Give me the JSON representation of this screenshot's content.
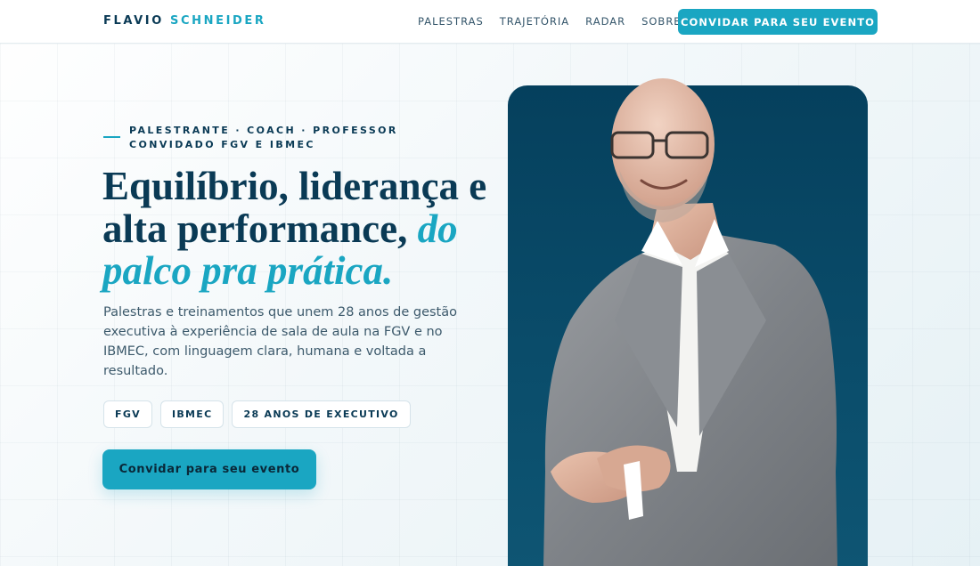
{
  "header": {
    "brand_first": "FLAVIO",
    "brand_second": "SCHNEIDER",
    "nav": [
      "PALESTRAS",
      "TRAJETÓRIA",
      "RADAR",
      "SOBRE"
    ],
    "cta": "CONVIDAR PARA SEU EVENTO"
  },
  "hero": {
    "eyebrow": "PALESTRANTE · COACH · PROFESSOR CONVIDADO FGV E IBMEC",
    "headline_line1": "Equilíbrio, liderança e",
    "headline_line2": "alta performance, ",
    "headline_accent_a": "do",
    "headline_accent_b": "palco pra prática.",
    "lead": "Palestras e treinamentos que unem 28 anos de gestão executiva à experiência de sala de aula na FGV e no IBMEC, com linguagem clara, humana e voltada a resultado.",
    "tags": [
      "FGV",
      "IBMEC",
      "28 ANOS DE EXECUTIVO"
    ],
    "cta": "Convidar para seu evento"
  },
  "colors": {
    "navy": "#0a3a55",
    "accent": "#1aa6c2",
    "card": "#05405d"
  }
}
